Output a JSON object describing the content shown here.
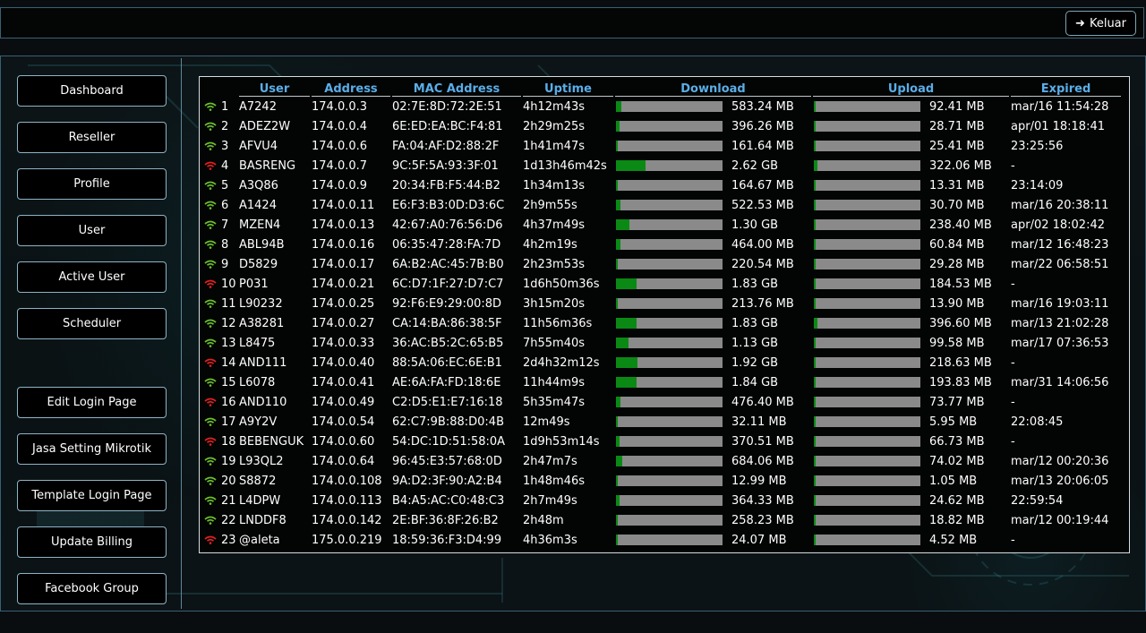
{
  "header": {
    "logout_label": "Keluar",
    "logout_icon": "arrow-right-icon"
  },
  "sidebar": {
    "items": [
      {
        "label": "Dashboard"
      },
      {
        "label": "Reseller"
      },
      {
        "label": "Profile"
      },
      {
        "label": "User"
      },
      {
        "label": "Active User"
      },
      {
        "label": "Scheduler"
      },
      {
        "label": "Edit Login Page"
      },
      {
        "label": "Jasa Setting Mikrotik"
      },
      {
        "label": "Template Login Page"
      },
      {
        "label": "Update Billing"
      },
      {
        "label": "Facebook Group"
      }
    ]
  },
  "colors": {
    "accent": "#5aaee8",
    "wifi_active": "#6abf2a",
    "wifi_inactive": "#e02020",
    "bar_track": "#8a8a8a",
    "bar_fill": "#0a8a14"
  },
  "table": {
    "columns": [
      "User",
      "Address",
      "MAC Address",
      "Uptime",
      "Download",
      "Upload",
      "Expired"
    ],
    "rows": [
      {
        "no": "1",
        "status": "green",
        "user": "A7242",
        "address": "174.0.0.3",
        "mac": "02:7E:8D:72:2E:51",
        "uptime": "4h12m43s",
        "download": "583.24 MB",
        "dl_fill": 0.05,
        "upload": "92.41 MB",
        "ul_fill": 0.02,
        "expired": "mar/16 11:54:28"
      },
      {
        "no": "2",
        "status": "green",
        "user": "ADEZ2W",
        "address": "174.0.0.4",
        "mac": "6E:ED:EA:BC:F4:81",
        "uptime": "2h29m25s",
        "download": "396.26 MB",
        "dl_fill": 0.03,
        "upload": "28.71 MB",
        "ul_fill": 0.01,
        "expired": "apr/01 18:18:41"
      },
      {
        "no": "3",
        "status": "green",
        "user": "AFVU4",
        "address": "174.0.0.6",
        "mac": "FA:04:AF:D2:88:2F",
        "uptime": "1h41m47s",
        "download": "161.64 MB",
        "dl_fill": 0.02,
        "upload": "25.41 MB",
        "ul_fill": 0.01,
        "expired": "23:25:56"
      },
      {
        "no": "4",
        "status": "red",
        "user": "BASRENG",
        "address": "174.0.0.7",
        "mac": "9C:5F:5A:93:3F:01",
        "uptime": "1d13h46m42s",
        "download": "2.62 GB",
        "dl_fill": 0.28,
        "upload": "322.06 MB",
        "ul_fill": 0.03,
        "expired": "-"
      },
      {
        "no": "5",
        "status": "green",
        "user": "A3Q86",
        "address": "174.0.0.9",
        "mac": "20:34:FB:F5:44:B2",
        "uptime": "1h34m13s",
        "download": "164.67 MB",
        "dl_fill": 0.02,
        "upload": "13.31 MB",
        "ul_fill": 0.005,
        "expired": "23:14:09"
      },
      {
        "no": "6",
        "status": "green",
        "user": "A1424",
        "address": "174.0.0.11",
        "mac": "E6:F3:B3:0D:D3:6C",
        "uptime": "2h9m55s",
        "download": "522.53 MB",
        "dl_fill": 0.04,
        "upload": "30.70 MB",
        "ul_fill": 0.01,
        "expired": "mar/16 20:38:11"
      },
      {
        "no": "7",
        "status": "green",
        "user": "MZEN4",
        "address": "174.0.0.13",
        "mac": "42:67:A0:76:56:D6",
        "uptime": "4h37m49s",
        "download": "1.30 GB",
        "dl_fill": 0.13,
        "upload": "238.40 MB",
        "ul_fill": 0.02,
        "expired": "apr/02 18:02:42"
      },
      {
        "no": "8",
        "status": "green",
        "user": "ABL94B",
        "address": "174.0.0.16",
        "mac": "06:35:47:28:FA:7D",
        "uptime": "4h2m19s",
        "download": "464.00 MB",
        "dl_fill": 0.04,
        "upload": "60.84 MB",
        "ul_fill": 0.01,
        "expired": "mar/12 16:48:23"
      },
      {
        "no": "9",
        "status": "green",
        "user": "D5829",
        "address": "174.0.0.17",
        "mac": "6A:B2:AC:45:7B:B0",
        "uptime": "2h23m53s",
        "download": "220.54 MB",
        "dl_fill": 0.02,
        "upload": "29.28 MB",
        "ul_fill": 0.01,
        "expired": "mar/22 06:58:51"
      },
      {
        "no": "10",
        "status": "red",
        "user": "P031",
        "address": "174.0.0.21",
        "mac": "6C:D7:1F:27:D7:C7",
        "uptime": "1d6h50m36s",
        "download": "1.83 GB",
        "dl_fill": 0.19,
        "upload": "184.53 MB",
        "ul_fill": 0.02,
        "expired": "-"
      },
      {
        "no": "11",
        "status": "green",
        "user": "L90232",
        "address": "174.0.0.25",
        "mac": "92:F6:E9:29:00:8D",
        "uptime": "3h15m20s",
        "download": "213.76 MB",
        "dl_fill": 0.02,
        "upload": "13.90 MB",
        "ul_fill": 0.005,
        "expired": "mar/16 19:03:11"
      },
      {
        "no": "12",
        "status": "green",
        "user": "A38281",
        "address": "174.0.0.27",
        "mac": "CA:14:BA:86:38:5F",
        "uptime": "11h56m36s",
        "download": "1.83 GB",
        "dl_fill": 0.19,
        "upload": "396.60 MB",
        "ul_fill": 0.03,
        "expired": "mar/13 21:02:28"
      },
      {
        "no": "13",
        "status": "green",
        "user": "L8475",
        "address": "174.0.0.33",
        "mac": "36:AC:B5:2C:65:B5",
        "uptime": "7h55m40s",
        "download": "1.13 GB",
        "dl_fill": 0.12,
        "upload": "99.58 MB",
        "ul_fill": 0.01,
        "expired": "mar/17 07:36:53"
      },
      {
        "no": "14",
        "status": "red",
        "user": "AND111",
        "address": "174.0.0.40",
        "mac": "88:5A:06:EC:6E:B1",
        "uptime": "2d4h32m12s",
        "download": "1.92 GB",
        "dl_fill": 0.2,
        "upload": "218.63 MB",
        "ul_fill": 0.02,
        "expired": "-"
      },
      {
        "no": "15",
        "status": "green",
        "user": "L6078",
        "address": "174.0.0.41",
        "mac": "AE:6A:FA:FD:18:6E",
        "uptime": "11h44m9s",
        "download": "1.84 GB",
        "dl_fill": 0.19,
        "upload": "193.83 MB",
        "ul_fill": 0.02,
        "expired": "mar/31 14:06:56"
      },
      {
        "no": "16",
        "status": "red",
        "user": "AND110",
        "address": "174.0.0.49",
        "mac": "C2:D5:E1:E7:16:18",
        "uptime": "5h35m47s",
        "download": "476.40 MB",
        "dl_fill": 0.04,
        "upload": "73.77 MB",
        "ul_fill": 0.01,
        "expired": "-"
      },
      {
        "no": "17",
        "status": "green",
        "user": "A9Y2V",
        "address": "174.0.0.54",
        "mac": "62:C7:9B:88:D0:4B",
        "uptime": "12m49s",
        "download": "32.11 MB",
        "dl_fill": 0.005,
        "upload": "5.95 MB",
        "ul_fill": 0.003,
        "expired": "22:08:45"
      },
      {
        "no": "18",
        "status": "red",
        "user": "BEBENGUK",
        "address": "174.0.0.60",
        "mac": "54:DC:1D:51:58:0A",
        "uptime": "1d9h53m14s",
        "download": "370.51 MB",
        "dl_fill": 0.03,
        "upload": "66.73 MB",
        "ul_fill": 0.01,
        "expired": "-"
      },
      {
        "no": "19",
        "status": "green",
        "user": "L93QL2",
        "address": "174.0.0.64",
        "mac": "96:45:E3:57:68:0D",
        "uptime": "2h47m7s",
        "download": "684.06 MB",
        "dl_fill": 0.06,
        "upload": "74.02 MB",
        "ul_fill": 0.01,
        "expired": "mar/12 00:20:36"
      },
      {
        "no": "20",
        "status": "green",
        "user": "S8872",
        "address": "174.0.0.108",
        "mac": "9A:D2:3F:90:A2:B4",
        "uptime": "1h48m46s",
        "download": "12.99 MB",
        "dl_fill": 0.003,
        "upload": "1.05 MB",
        "ul_fill": 0.002,
        "expired": "mar/13 20:06:05"
      },
      {
        "no": "21",
        "status": "green",
        "user": "L4DPW",
        "address": "174.0.0.113",
        "mac": "B4:A5:AC:C0:48:C3",
        "uptime": "2h7m49s",
        "download": "364.33 MB",
        "dl_fill": 0.03,
        "upload": "24.62 MB",
        "ul_fill": 0.01,
        "expired": "22:59:54"
      },
      {
        "no": "22",
        "status": "green",
        "user": "LNDDF8",
        "address": "174.0.0.142",
        "mac": "2E:BF:36:8F:26:B2",
        "uptime": "2h48m",
        "download": "258.23 MB",
        "dl_fill": 0.02,
        "upload": "18.82 MB",
        "ul_fill": 0.005,
        "expired": "mar/12 00:19:44"
      },
      {
        "no": "23",
        "status": "red",
        "user": "@aleta",
        "address": "175.0.0.219",
        "mac": "18:59:36:F3:D4:99",
        "uptime": "4h36m3s",
        "download": "24.07 MB",
        "dl_fill": 0.004,
        "upload": "4.52 MB",
        "ul_fill": 0.002,
        "expired": "-"
      }
    ]
  }
}
